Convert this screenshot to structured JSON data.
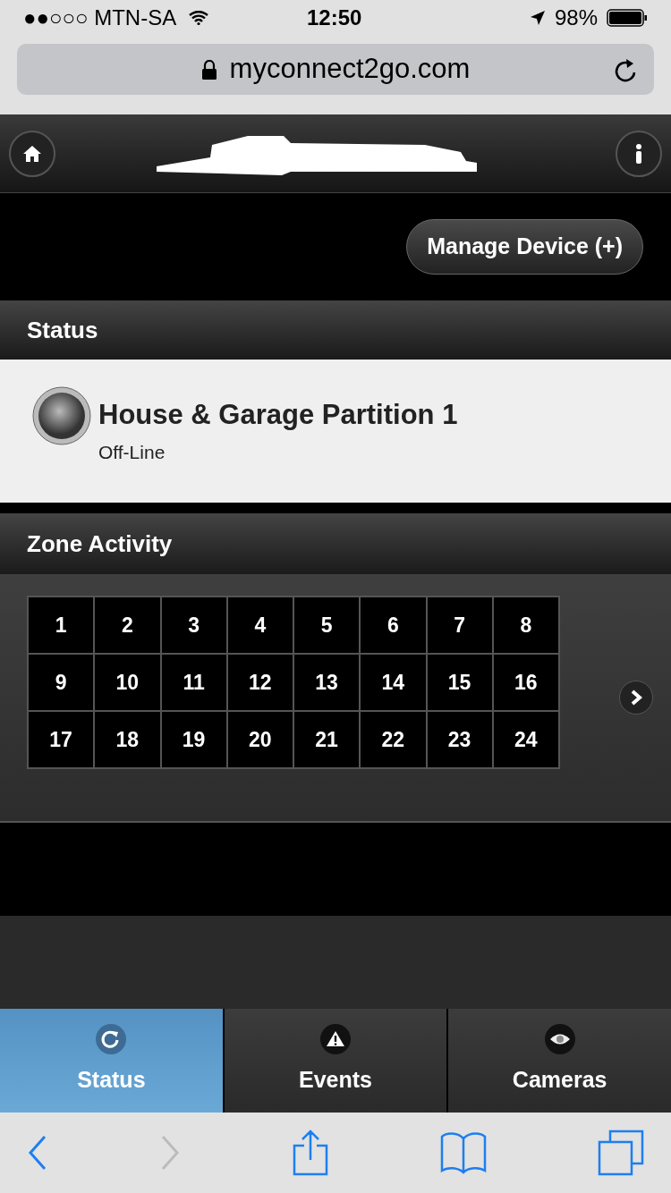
{
  "status_bar": {
    "carrier": "●●○○○ MTN-SA",
    "time": "12:50",
    "battery": "98%"
  },
  "address_bar": {
    "url": "myconnect2go.com"
  },
  "manage_button": "Manage Device (+)",
  "status_section": {
    "title": "Status",
    "partition": {
      "name": "House & Garage Partition 1",
      "state": "Off-Line"
    }
  },
  "zone_section": {
    "title": "Zone Activity",
    "zones": [
      "1",
      "2",
      "3",
      "4",
      "5",
      "6",
      "7",
      "8",
      "9",
      "10",
      "11",
      "12",
      "13",
      "14",
      "15",
      "16",
      "17",
      "18",
      "19",
      "20",
      "21",
      "22",
      "23",
      "24"
    ]
  },
  "tabs": [
    {
      "label": "Status",
      "kind": "status",
      "selected": true
    },
    {
      "label": "Events",
      "kind": "events",
      "selected": false
    },
    {
      "label": "Cameras",
      "kind": "cameras",
      "selected": false
    }
  ]
}
